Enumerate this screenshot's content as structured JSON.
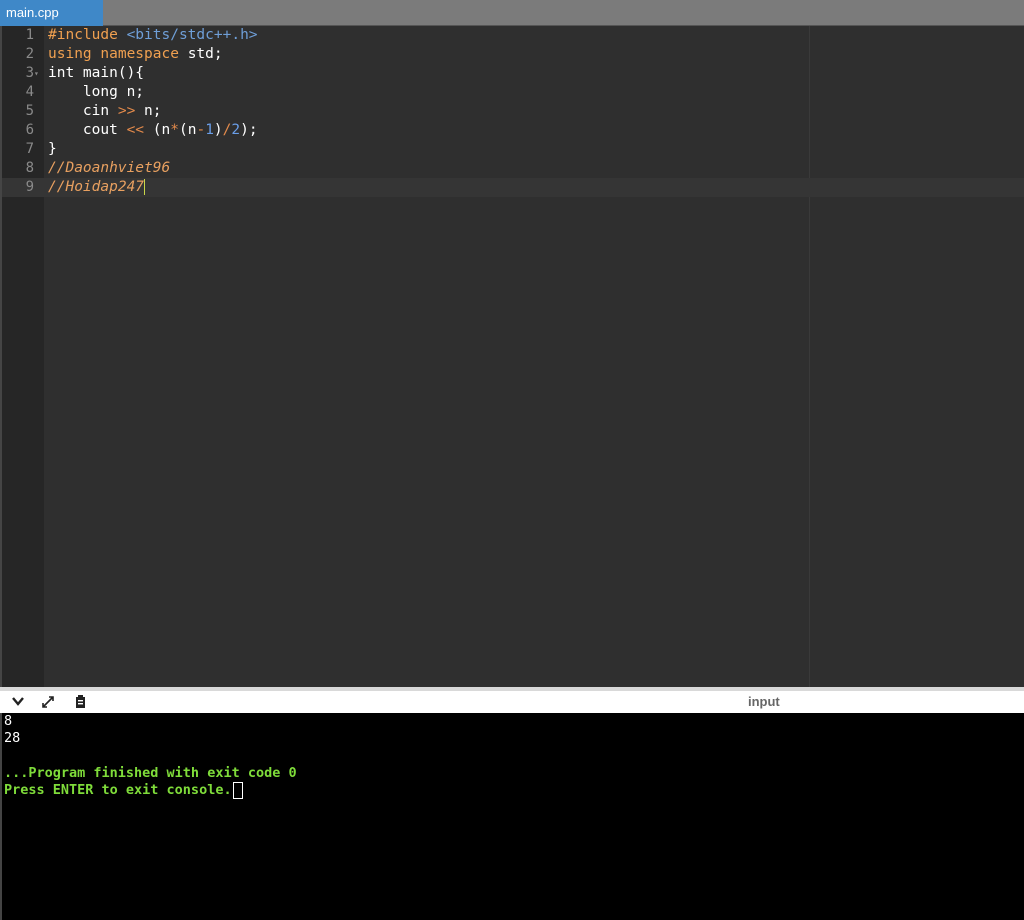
{
  "tab": {
    "label": "main.cpp"
  },
  "editor": {
    "line_numbers": [
      "1",
      "2",
      "3",
      "4",
      "5",
      "6",
      "7",
      "8",
      "9"
    ],
    "lines": [
      [
        {
          "t": "#include ",
          "c": "kw"
        },
        {
          "t": "<bits/stdc++.h>",
          "c": "str"
        }
      ],
      [
        {
          "t": "using ",
          "c": "kw"
        },
        {
          "t": "namespace ",
          "c": "kw"
        },
        {
          "t": "std;",
          "c": "w"
        }
      ],
      [
        {
          "t": "int main(){",
          "c": "w"
        }
      ],
      [
        {
          "t": "    long n;",
          "c": "w"
        }
      ],
      [
        {
          "t": "    cin ",
          "c": "w"
        },
        {
          "t": ">>",
          "c": "op"
        },
        {
          "t": " n;",
          "c": "w"
        }
      ],
      [
        {
          "t": "    cout ",
          "c": "w"
        },
        {
          "t": "<<",
          "c": "op"
        },
        {
          "t": " (n",
          "c": "w"
        },
        {
          "t": "*",
          "c": "op"
        },
        {
          "t": "(n",
          "c": "w"
        },
        {
          "t": "-",
          "c": "op"
        },
        {
          "t": "1",
          "c": "num"
        },
        {
          "t": ")",
          "c": "w"
        },
        {
          "t": "/",
          "c": "op"
        },
        {
          "t": "2",
          "c": "num"
        },
        {
          "t": ");",
          "c": "w"
        }
      ],
      [
        {
          "t": "}",
          "c": "w"
        }
      ],
      [
        {
          "t": "//Daoanhviet96",
          "c": "cmt"
        }
      ],
      [
        {
          "t": "//Hoidap247",
          "c": "cmt"
        }
      ]
    ],
    "fold_line": "3",
    "active_line": "9"
  },
  "console_toolbar": {
    "collapse_icon": "chevron-down-icon",
    "expand_icon": "expand-icon",
    "copy_icon": "clipboard-icon",
    "input_label": "input"
  },
  "console": {
    "input_value": "8",
    "output_value": "28",
    "finished_message": "...Program finished with exit code 0",
    "exit_prompt": "Press ENTER to exit console."
  }
}
